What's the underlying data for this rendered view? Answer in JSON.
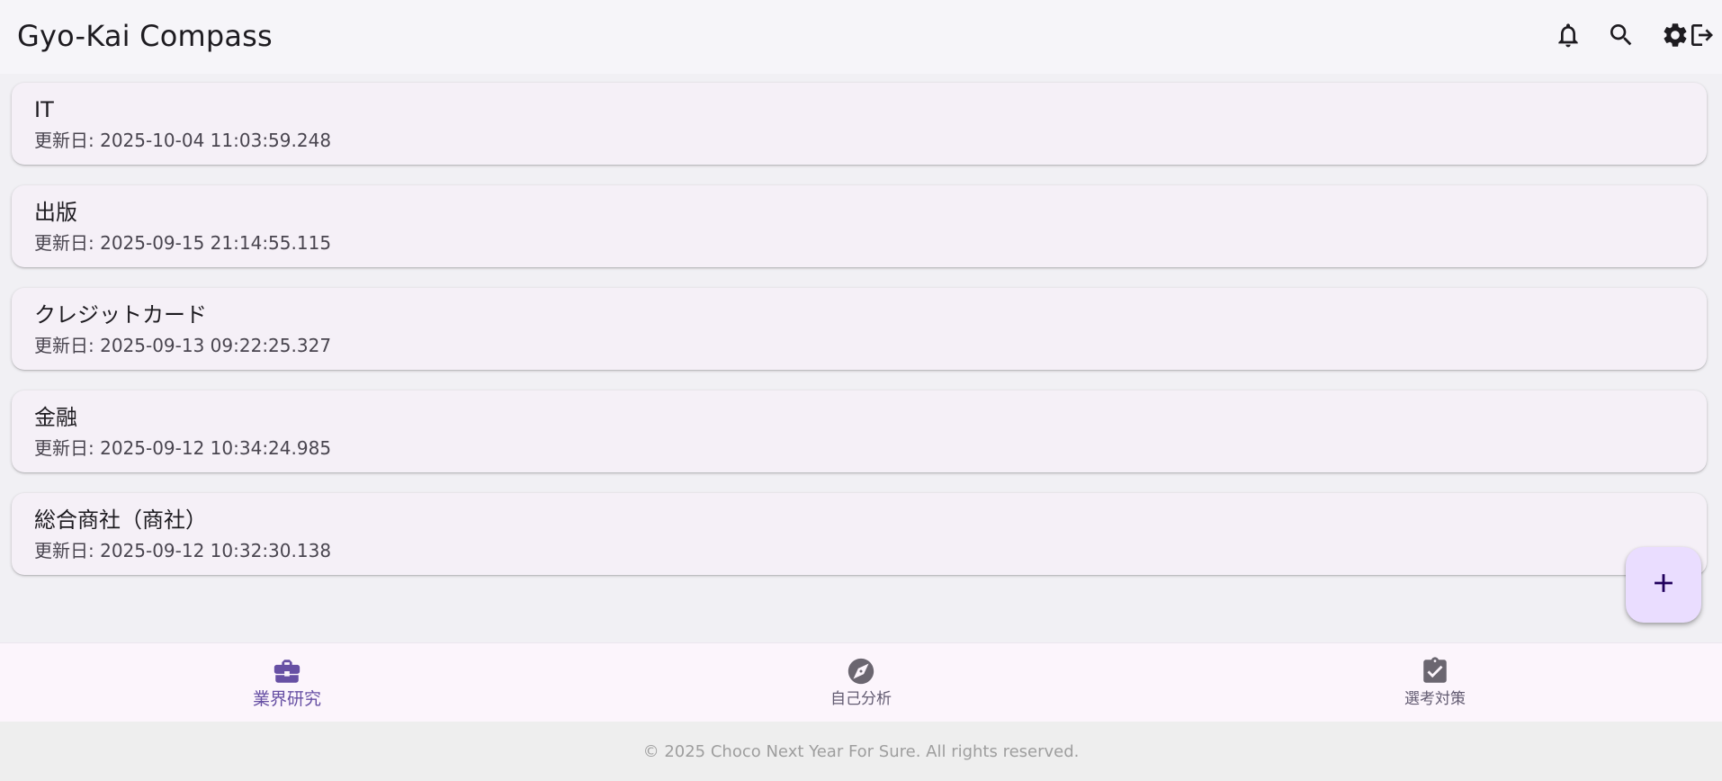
{
  "app": {
    "title": "Gyo-Kai Compass"
  },
  "toolbar": {
    "actions": [
      {
        "name": "notifications",
        "icon": "bell-icon"
      },
      {
        "name": "search",
        "icon": "search-icon"
      },
      {
        "name": "settings",
        "icon": "gear-icon"
      },
      {
        "name": "logout",
        "icon": "logout-icon"
      }
    ]
  },
  "industries": [
    {
      "title": "IT",
      "updated": "更新日: 2025-10-04 11:03:59.248"
    },
    {
      "title": "出版",
      "updated": "更新日: 2025-09-15 21:14:55.115"
    },
    {
      "title": "クレジットカード",
      "updated": "更新日: 2025-09-13 09:22:25.327"
    },
    {
      "title": "金融",
      "updated": "更新日: 2025-09-12 10:34:24.985"
    },
    {
      "title": "総合商社（商社）",
      "updated": "更新日: 2025-09-12 10:32:30.138"
    }
  ],
  "fab": {
    "icon": "plus-icon"
  },
  "nav": {
    "items": [
      {
        "label": "業界研究",
        "icon": "briefcase-icon",
        "active": true
      },
      {
        "label": "自己分析",
        "icon": "compass-icon",
        "active": false
      },
      {
        "label": "選考対策",
        "icon": "clipboard-check-icon",
        "active": false
      }
    ]
  },
  "footer": {
    "text": "© 2025 Choco Next Year For Sure. All rights reserved."
  },
  "colors": {
    "primary": "#6750a4",
    "fab_background": "#eaddff",
    "card_background": "#f5f0f7",
    "appbar_background": "#f6f5f9",
    "nav_background": "#fcf5fc",
    "footer_background": "#eeeeee"
  }
}
